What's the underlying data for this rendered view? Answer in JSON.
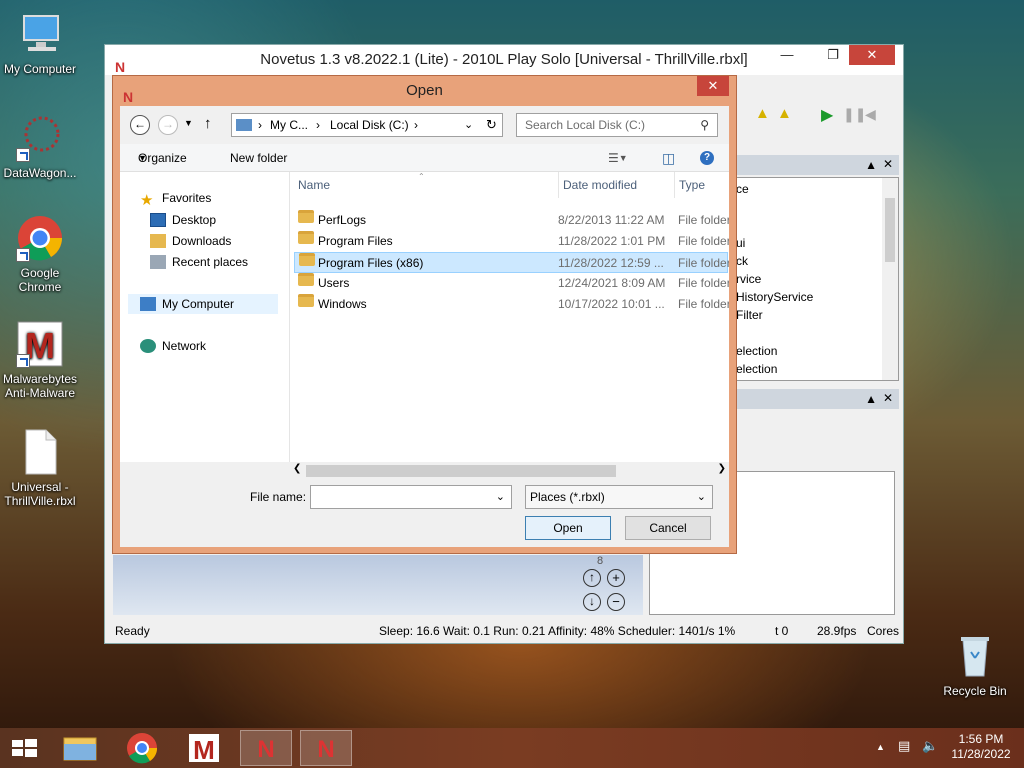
{
  "desktop": {
    "icons": [
      {
        "label": "My Computer"
      },
      {
        "label": "DataWagon..."
      },
      {
        "label": "Google Chrome"
      },
      {
        "label": "Malwarebytes Anti-Malware"
      },
      {
        "label": "Universal - ThrillVille.rbxl"
      },
      {
        "label": "Recycle Bin"
      }
    ]
  },
  "main_window": {
    "title": "Novetus 1.3 v8.2022.1 (Lite) - 2010L Play Solo [Universal - ThrillVille.rbxl]",
    "explorer_items": [
      "ce",
      "",
      "",
      "ui",
      "ck",
      "rvice",
      "HistoryService",
      "Filter",
      "",
      "election",
      "election"
    ],
    "status": {
      "ready": "Ready",
      "stats": "Sleep: 16.6 Wait: 0.1 Run: 0.21 Affinity: 48% Scheduler: 1401/s 1%",
      "t": "t 0",
      "fps": "28.9fps",
      "cores": "Cores"
    },
    "viewport_digit": "8"
  },
  "dialog": {
    "title": "Open",
    "address": {
      "seg1": "My C...",
      "seg2": "Local Disk (C:)"
    },
    "search_placeholder": "Search Local Disk (C:)",
    "organize": "Organize",
    "new_folder": "New folder",
    "nav": {
      "favorites": "Favorites",
      "desktop": "Desktop",
      "downloads": "Downloads",
      "recent": "Recent places",
      "my_computer": "My Computer",
      "network": "Network"
    },
    "columns": {
      "name": "Name",
      "date": "Date modified",
      "type": "Type"
    },
    "files": [
      {
        "name": "PerfLogs",
        "date": "8/22/2013 11:22 AM",
        "type": "File folder"
      },
      {
        "name": "Program Files",
        "date": "11/28/2022 1:01 PM",
        "type": "File folder"
      },
      {
        "name": "Program Files (x86)",
        "date": "11/28/2022 12:59 ...",
        "type": "File folder"
      },
      {
        "name": "Users",
        "date": "12/24/2021 8:09 AM",
        "type": "File folder"
      },
      {
        "name": "Windows",
        "date": "10/17/2022 10:01 ...",
        "type": "File folder"
      }
    ],
    "file_name_label": "File name:",
    "file_name_value": "",
    "file_type": "Places (*.rbxl)",
    "open_label": "Open",
    "cancel_label": "Cancel"
  },
  "tray": {
    "time": "1:56 PM",
    "date": "11/28/2022"
  }
}
